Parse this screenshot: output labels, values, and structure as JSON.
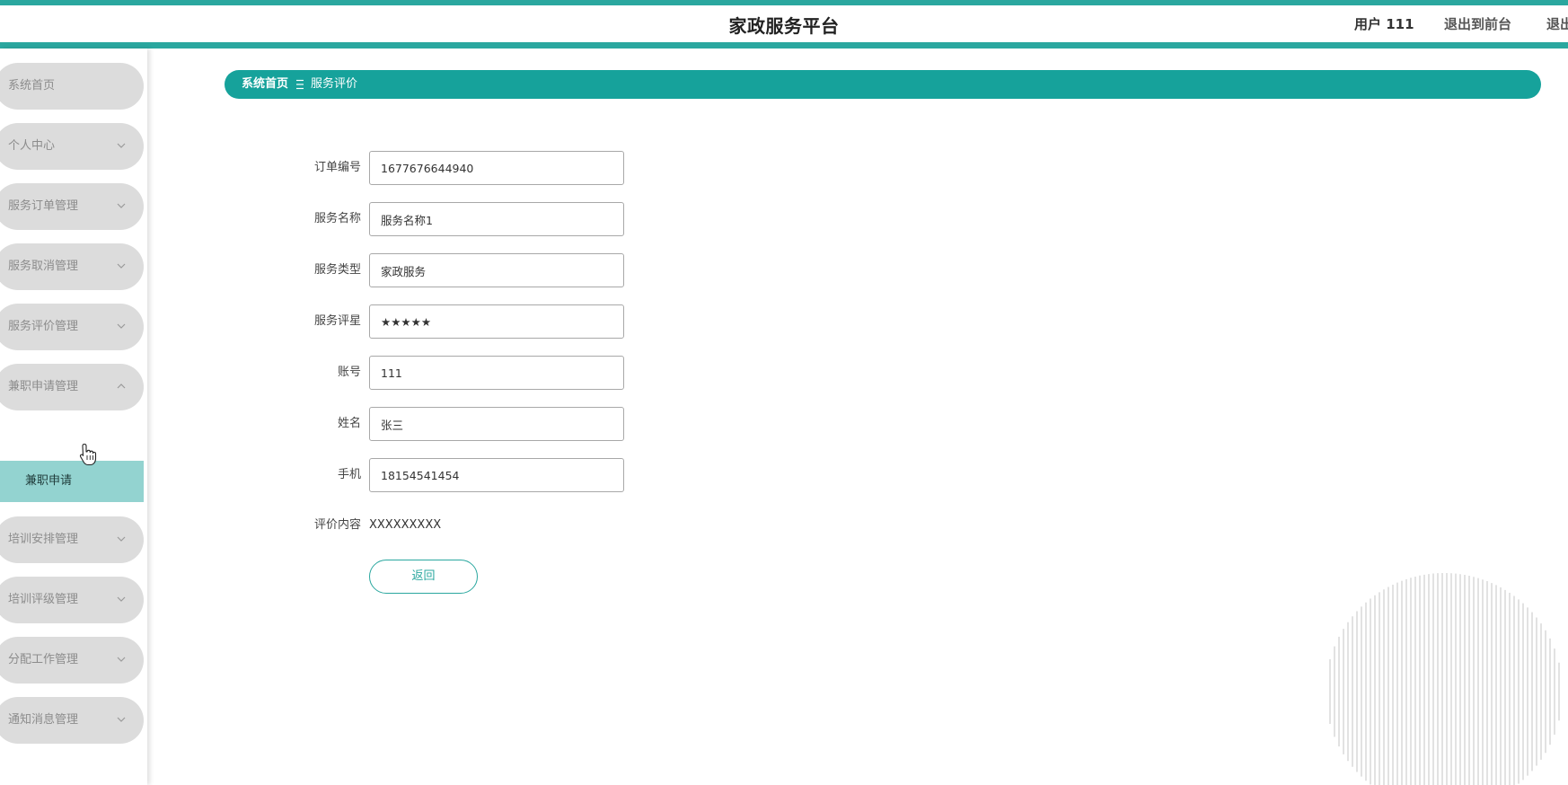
{
  "header": {
    "title": "家政服务平台",
    "user": "用户 111",
    "front_link": "退出到前台",
    "logout_link": "退出"
  },
  "sidebar": {
    "items": [
      {
        "label": "系统首页",
        "chevron": "none"
      },
      {
        "label": "个人中心",
        "chevron": "down"
      },
      {
        "label": "服务订单管理",
        "chevron": "down"
      },
      {
        "label": "服务取消管理",
        "chevron": "down"
      },
      {
        "label": "服务评价管理",
        "chevron": "down"
      },
      {
        "label": "兼职申请管理",
        "chevron": "up"
      },
      {
        "label": "培训安排管理",
        "chevron": "down"
      },
      {
        "label": "培训评级管理",
        "chevron": "down"
      },
      {
        "label": "分配工作管理",
        "chevron": "down"
      },
      {
        "label": "通知消息管理",
        "chevron": "down"
      }
    ],
    "active_sub_item": "兼职申请"
  },
  "breadcrumb": {
    "home": "系统首页",
    "separator_icon": "menu-lines-icon",
    "current": "服务评价"
  },
  "form": {
    "order_no": {
      "label": "订单编号",
      "value": "1677676644940"
    },
    "service_name": {
      "label": "服务名称",
      "value": "服务名称1"
    },
    "service_type": {
      "label": "服务类型",
      "value": "家政服务"
    },
    "rating": {
      "label": "服务评星",
      "value": "★★★★★"
    },
    "account": {
      "label": "账号",
      "value": "111"
    },
    "name": {
      "label": "姓名",
      "value": "张三"
    },
    "phone": {
      "label": "手机",
      "value": "18154541454"
    },
    "comment": {
      "label": "评价内容",
      "value": "XXXXXXXXX"
    },
    "back_label": "返回"
  },
  "colors": {
    "accent": "#2aa79f",
    "breadcrumb_bg": "#16a29b",
    "menu_bg": "#dcdcdc",
    "submenu_active": "#93d3d0"
  }
}
